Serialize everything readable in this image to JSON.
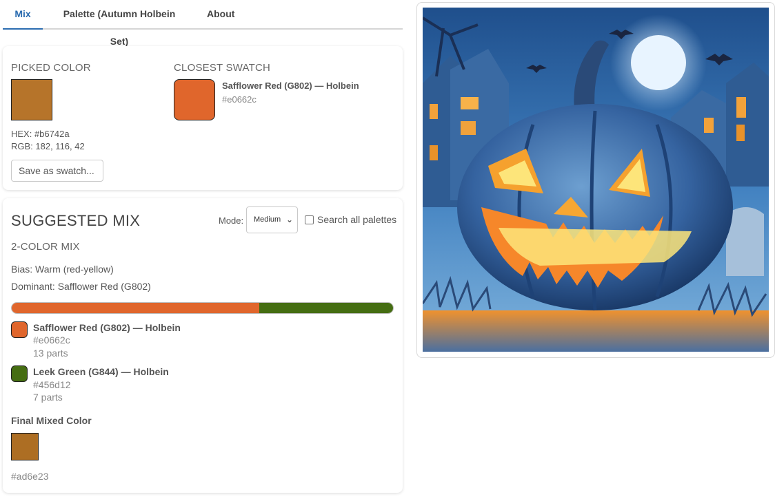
{
  "tabs": [
    {
      "label": "Mix",
      "active": true
    },
    {
      "label": "Palette (Autumn Holbein Set)",
      "active": false
    },
    {
      "label": "About",
      "active": false
    }
  ],
  "picked": {
    "section_label": "PICKED COLOR",
    "color": "#b6742a",
    "hex_text": "HEX: #b6742a",
    "rgb_text": "RGB: 182, 116, 42",
    "save_button": "Save as swatch..."
  },
  "closest": {
    "section_label": "CLOSEST SWATCH",
    "name": "Safflower Red (G802) — Holbein",
    "hex": "#e0662c",
    "color": "#e0662c"
  },
  "suggested": {
    "title": "SUGGESTED MIX",
    "mode_label": "Mode:",
    "mode_value": "Medium",
    "search_all_label": "Search all palettes",
    "search_all_checked": false,
    "mix_type": "2-COLOR MIX",
    "bias": "Bias: Warm (red-yellow)",
    "dominant": "Dominant: Safflower Red (G802)",
    "ingredients": [
      {
        "name": "Safflower Red (G802) — Holbein",
        "hex": "#e0662c",
        "parts": "13 parts",
        "color": "#e0662c",
        "fraction": 0.65
      },
      {
        "name": "Leek Green (G844) — Holbein",
        "hex": "#456d12",
        "parts": "7 parts",
        "color": "#456d12",
        "fraction": 0.35
      }
    ],
    "final_title": "Final Mixed Color",
    "final_hex": "#ad6e23",
    "final_color": "#ad6e23"
  },
  "image": {
    "subject": "painting of a carved jack-o'-lantern pumpkin at night with bats, full moon and houses"
  },
  "colors": {
    "accent": "#2b6cb0"
  }
}
